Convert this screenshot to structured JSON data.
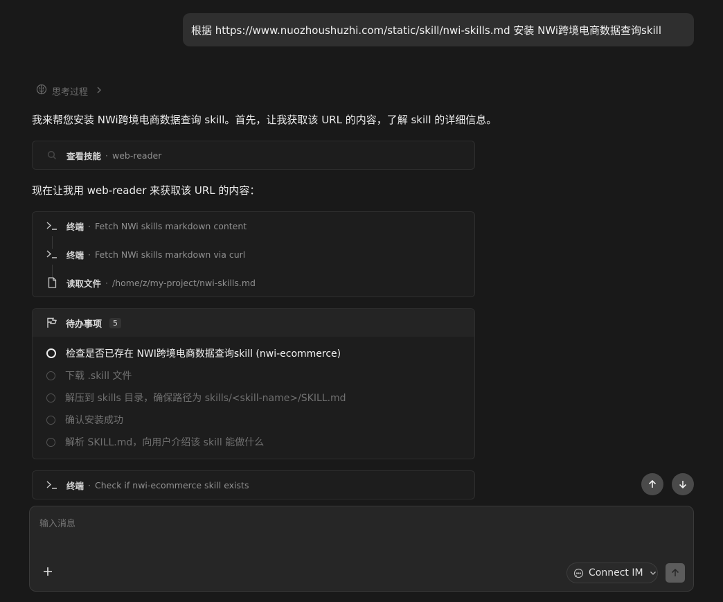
{
  "user_message": "根据 https://www.nuozhoushuzhi.com/static/skill/nwi-skills.md 安装 NWi跨境电商数据查询skill",
  "thinking_label": "思考过程",
  "intro_text": "我来帮您安装 NWi跨境电商数据查询 skill。首先，让我获取该 URL 的内容，了解 skill 的详细信息。",
  "skill_tool": {
    "icon": "search-icon",
    "title": "查看技能",
    "separator": "·",
    "detail": "web-reader"
  },
  "second_text": "现在让我用 web-reader 来获取该 URL 的内容：",
  "tool_calls": [
    {
      "icon": "terminal-icon",
      "title": "终端",
      "separator": "·",
      "detail": "Fetch NWi skills markdown content"
    },
    {
      "icon": "terminal-icon",
      "title": "终端",
      "separator": "·",
      "detail": "Fetch NWi skills markdown via curl"
    },
    {
      "icon": "file-icon",
      "title": "读取文件",
      "separator": "·",
      "detail": "/home/z/my-project/nwi-skills.md"
    }
  ],
  "todo": {
    "icon": "flag-icon",
    "title": "待办事项",
    "count": "5",
    "items": [
      {
        "text": "检查是否已存在 NWI跨境电商数据查询skill (nwi-ecommerce)",
        "status": "in_progress"
      },
      {
        "text": "下载 .skill 文件",
        "status": "pending"
      },
      {
        "text": "解压到 skills 目录，确保路径为 skills/<skill-name>/SKILL.md",
        "status": "pending"
      },
      {
        "text": "确认安装成功",
        "status": "pending"
      },
      {
        "text": "解析 SKILL.md，向用户介绍该 skill 能做什么",
        "status": "pending"
      }
    ]
  },
  "last_tool": {
    "icon": "terminal-icon",
    "title": "终端",
    "separator": "·",
    "detail": "Check if nwi-ecommerce skill exists"
  },
  "composer": {
    "placeholder": "输入消息",
    "connect_label": "Connect IM"
  },
  "colors": {
    "background": "#191919",
    "card": "#1d1d1d",
    "bubble": "#2f2f2f",
    "accent_button": "#4a4a4a"
  }
}
